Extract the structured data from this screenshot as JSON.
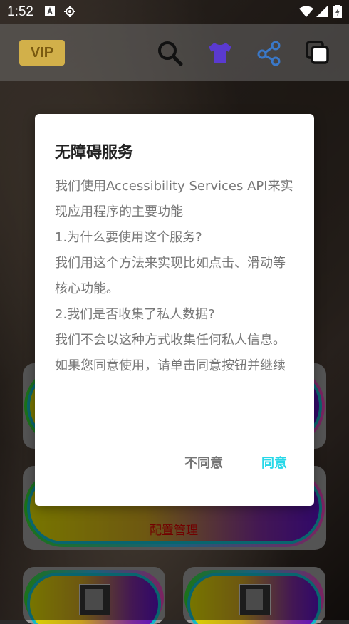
{
  "status_bar": {
    "time": "1:52",
    "icons": [
      "a-icon",
      "gps-icon",
      "wifi-icon",
      "signal-icon",
      "battery-icon"
    ]
  },
  "app_bar": {
    "vip_label": "VIP",
    "icons": [
      "search-icon",
      "tshirt-icon",
      "share-icon",
      "copy-icon"
    ]
  },
  "cards": {
    "config_label": "配置管理"
  },
  "dialog": {
    "title": "无障碍服务",
    "body": "我们使用Accessibility Services API来实现应用程序的主要功能\n1.为什么要使用这个服务?\n我们用这个方法来实现比如点击、滑动等核心功能。\n2.我们是否收集了私人数据?\n我们不会以这种方式收集任何私人信息。\n如果您同意使用，请单击同意按钮并继续",
    "disagree_label": "不同意",
    "agree_label": "同意"
  },
  "colors": {
    "accent": "#27d8e8",
    "vip_gold": "#d2b04a",
    "label_red": "#d00000"
  }
}
